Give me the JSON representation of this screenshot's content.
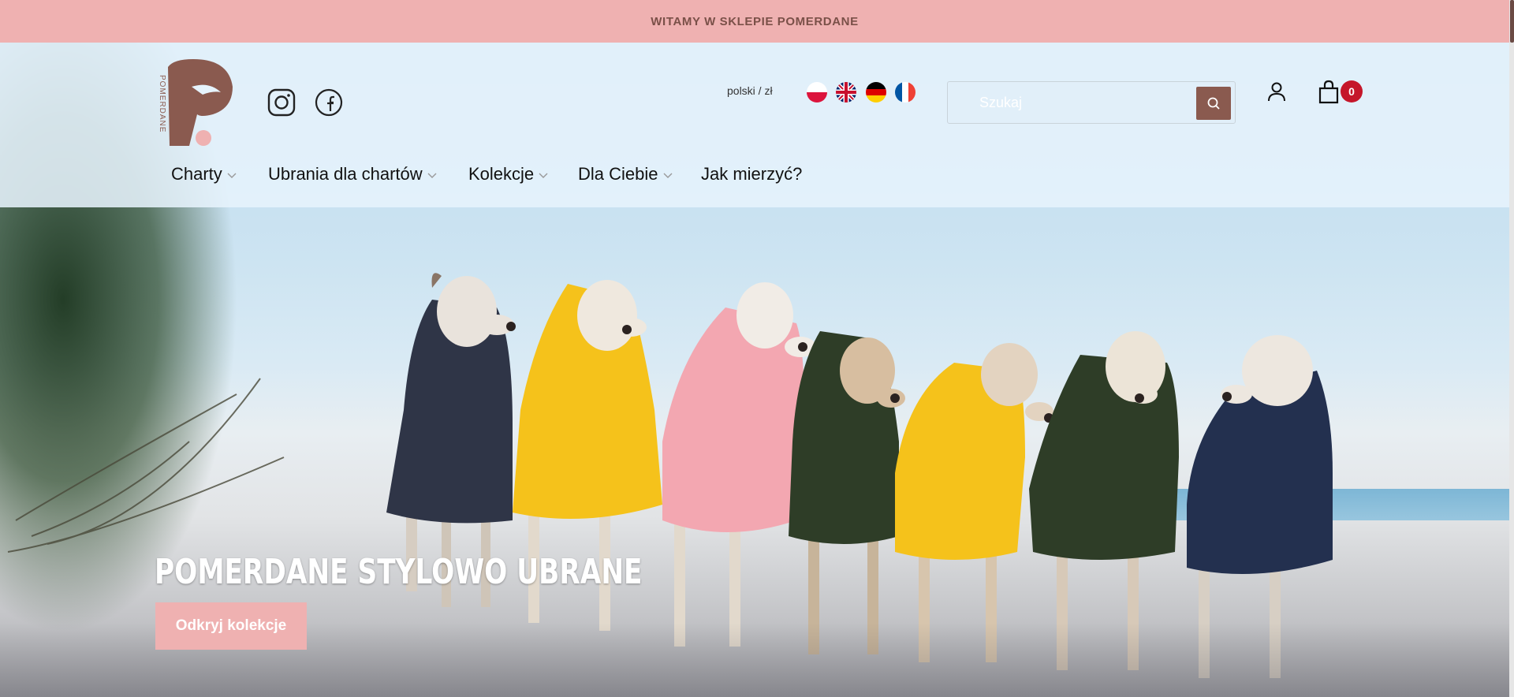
{
  "topbar": {
    "text": "WITAMY W SKLEPIE POMERDANE"
  },
  "brand": {
    "name": "POMERDANE",
    "color": "#8a5a4f",
    "accent": "#efb1b1"
  },
  "social": [
    {
      "name": "instagram-icon"
    },
    {
      "name": "facebook-icon"
    }
  ],
  "language": {
    "label": "polski / zł",
    "flags": [
      "pl",
      "gb",
      "de",
      "fr"
    ]
  },
  "search": {
    "placeholder": "Szukaj",
    "button_icon": "search-icon"
  },
  "cart": {
    "count": "0"
  },
  "nav": [
    {
      "label": "Charty",
      "has_dropdown": true
    },
    {
      "label": "Ubrania dla chartów",
      "has_dropdown": true
    },
    {
      "label": "Kolekcje",
      "has_dropdown": true
    },
    {
      "label": "Dla Ciebie",
      "has_dropdown": true
    },
    {
      "label": "Jak mierzyć?",
      "has_dropdown": false
    }
  ],
  "hero": {
    "title": "POMERDANE STYLOWO UBRANE",
    "cta": "Odkryj kolekcje"
  }
}
